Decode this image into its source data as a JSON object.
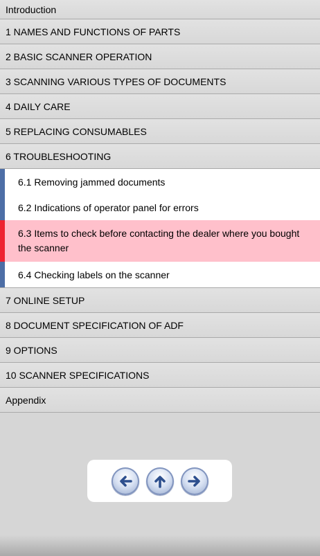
{
  "toc": {
    "intro": "Introduction",
    "ch1": "1 NAMES AND FUNCTIONS OF PARTS",
    "ch2": "2 BASIC SCANNER OPERATION",
    "ch3": "3 SCANNING VARIOUS TYPES OF DOCUMENTS",
    "ch4": "4 DAILY CARE",
    "ch5": "5 REPLACING CONSUMABLES",
    "ch6": "6 TROUBLESHOOTING",
    "sub61": "6.1 Removing jammed documents",
    "sub62": "6.2 Indications of operator panel for errors",
    "sub63": "6.3 Items to check before contacting the dealer where you bought the scanner",
    "sub64": "6.4 Checking labels on the scanner",
    "ch7": "7 ONLINE SETUP",
    "ch8": "8 DOCUMENT SPECIFICATION OF ADF",
    "ch9": "9 OPTIONS",
    "ch10": "10 SCANNER SPECIFICATIONS",
    "appendix": "Appendix"
  },
  "nav": {
    "icons": [
      "back-arrow-icon",
      "up-arrow-icon",
      "forward-arrow-icon"
    ]
  },
  "colors": {
    "active_bg": "#ffc0cb",
    "active_marker": "#ee2431",
    "sub_marker": "#4d6ea6",
    "nav_arrow": "#2d4f8e"
  }
}
